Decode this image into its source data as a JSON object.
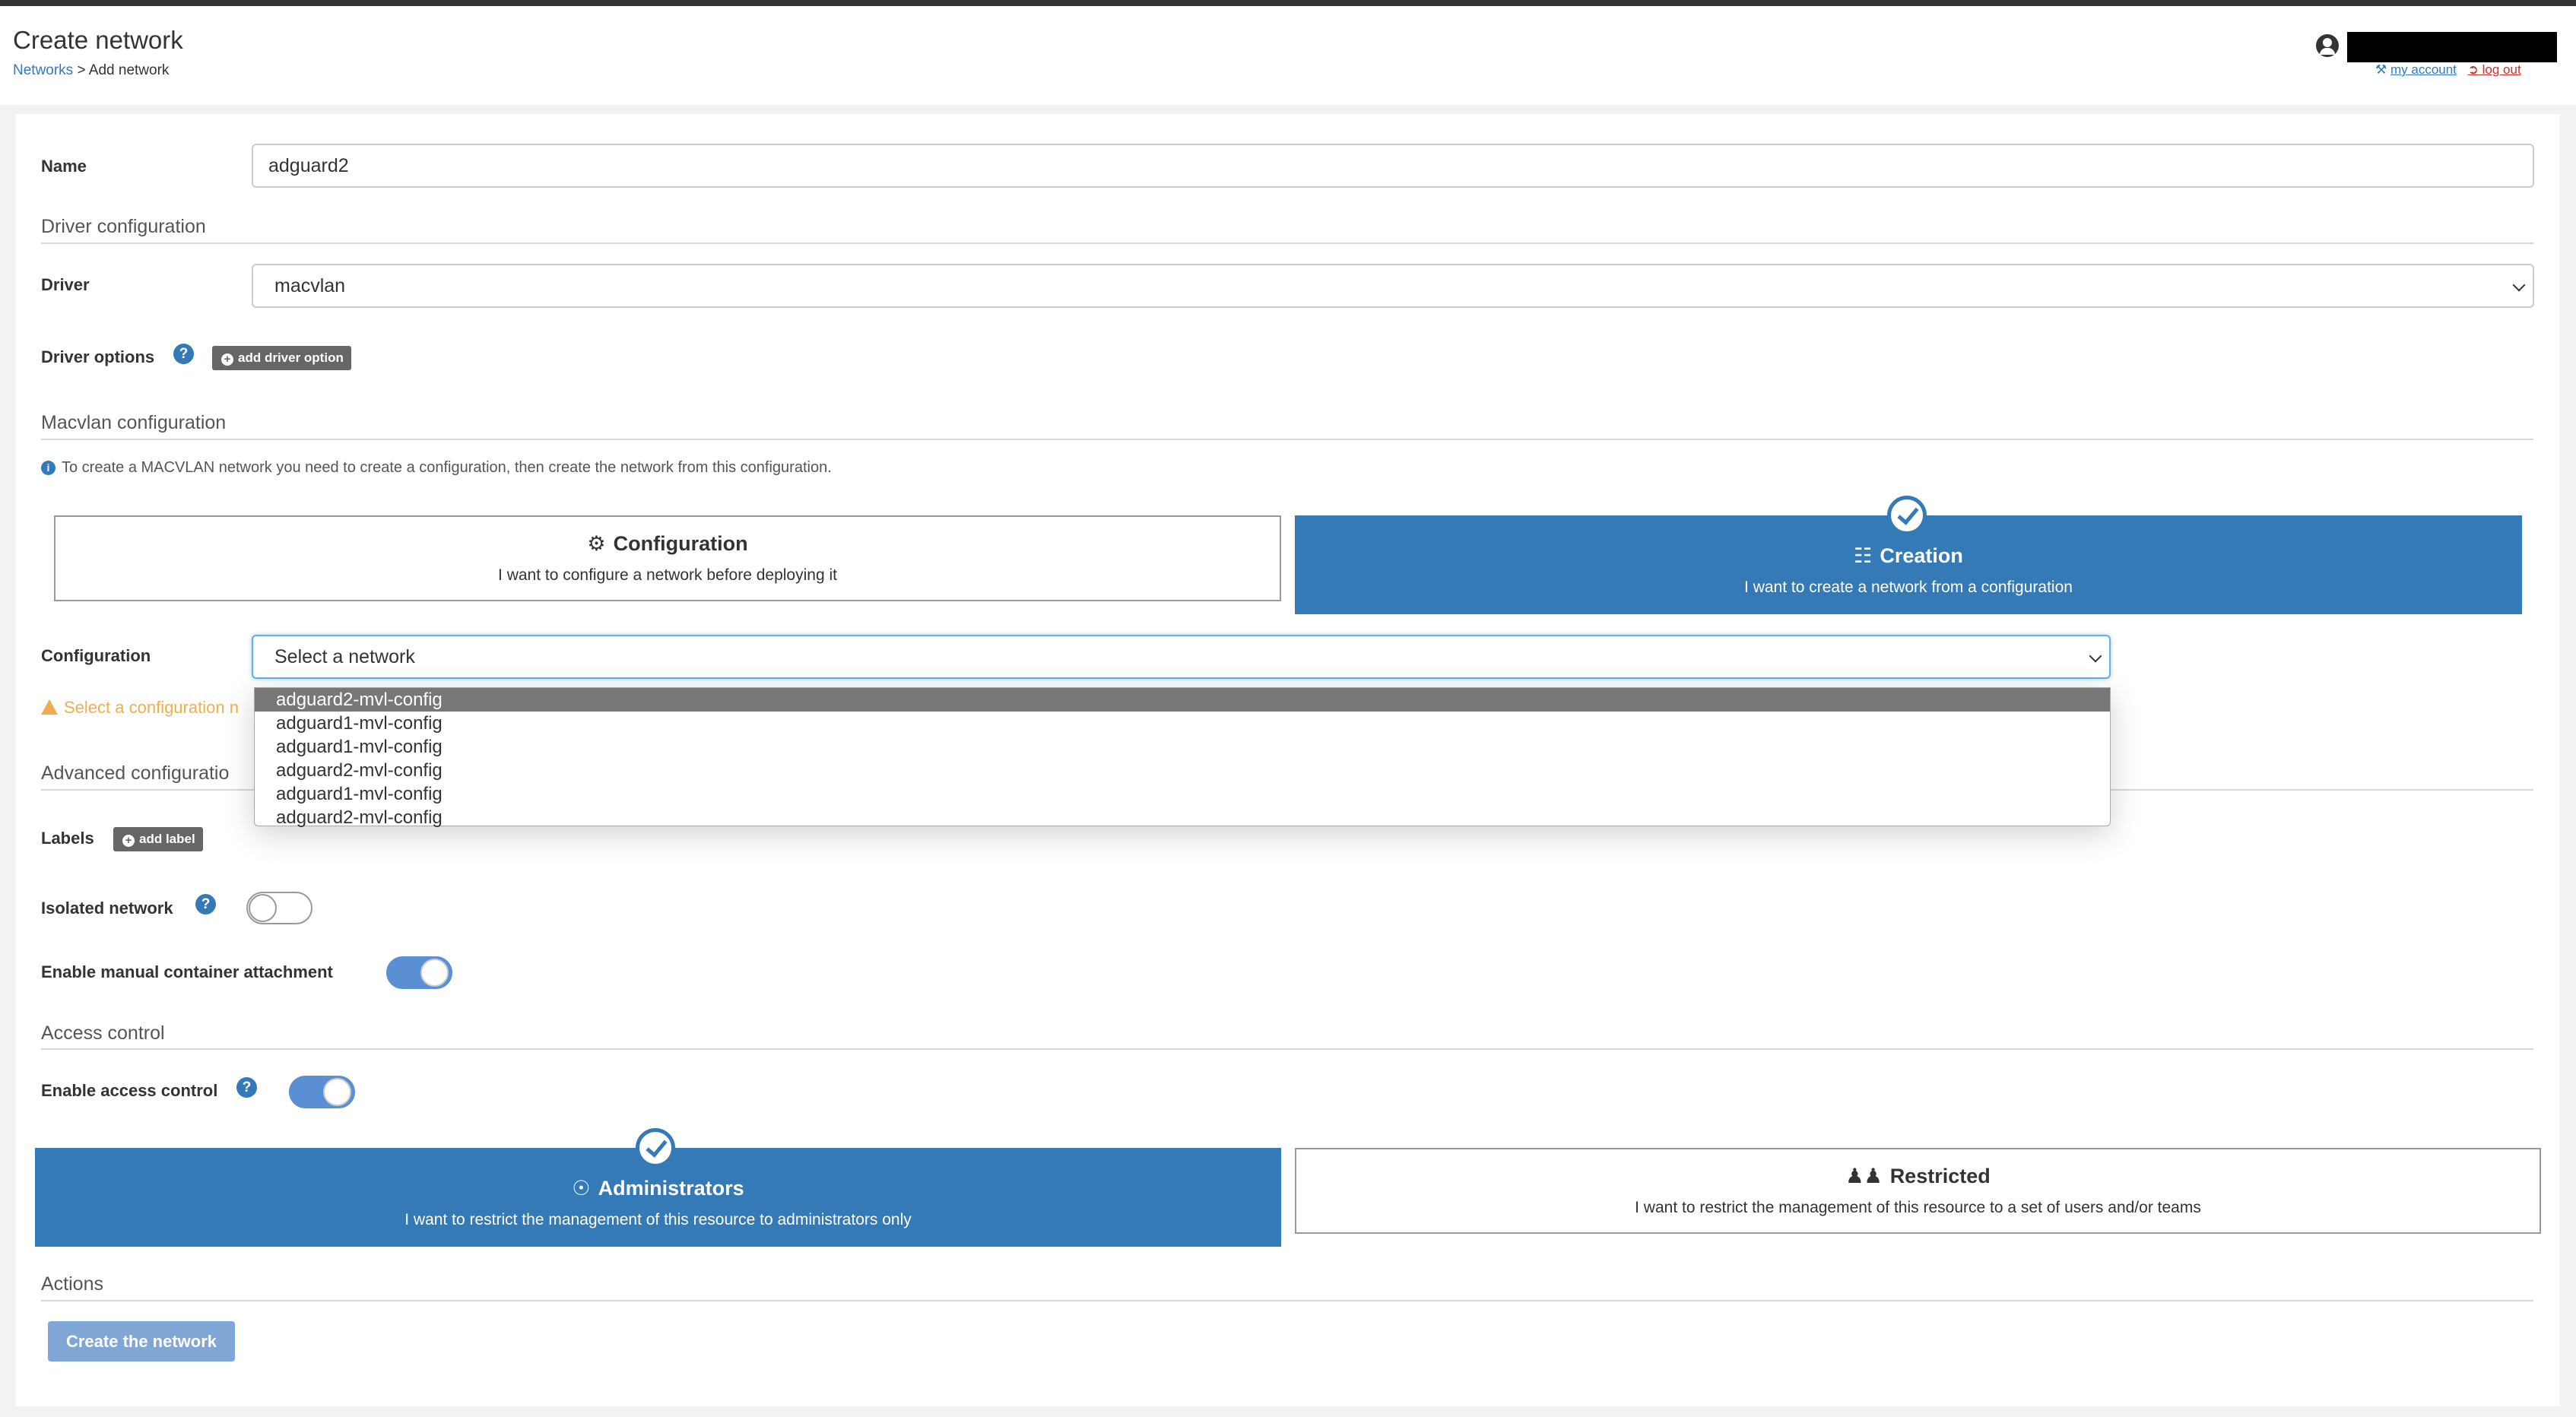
{
  "header": {
    "title": "Create network",
    "breadcrumb_link": "Networks",
    "breadcrumb_sep": " > ",
    "breadcrumb_current": "Add network",
    "user_name": "",
    "my_account": "my account",
    "log_out": "log out"
  },
  "form": {
    "name_label": "Name",
    "name_value": "adguard2",
    "driver_section": "Driver configuration",
    "driver_label": "Driver",
    "driver_value": "macvlan",
    "driver_options_label": "Driver options",
    "add_driver_option": "add driver option",
    "macvlan_section": "Macvlan configuration",
    "macvlan_info": "To create a MACVLAN network you need to create a configuration, then create the network from this configuration.",
    "mode_configuration": {
      "title": "Configuration",
      "desc": "I want to configure a network before deploying it",
      "icon": "gear-icon"
    },
    "mode_creation": {
      "title": "Creation",
      "desc": "I want to create a network from a configuration",
      "icon": "sitemap-icon",
      "selected": true
    },
    "configuration_label": "Configuration",
    "configuration_placeholder": "Select a network",
    "configuration_options": [
      "adguard2-mvl-config",
      "adguard1-mvl-config",
      "adguard1-mvl-config",
      "adguard2-mvl-config",
      "adguard1-mvl-config",
      "adguard2-mvl-config"
    ],
    "configuration_warning": "Select a configuration n",
    "advanced_section": "Advanced configuratio",
    "labels_label": "Labels",
    "add_label": "add label",
    "isolated_label": "Isolated network",
    "isolated_on": false,
    "manual_attach_label": "Enable manual container attachment",
    "manual_attach_on": true
  },
  "access": {
    "section": "Access control",
    "enable_label": "Enable access control",
    "enable_on": true,
    "admins": {
      "title": "Administrators",
      "desc": "I want to restrict the management of this resource to administrators only",
      "icon": "eye-slash-icon",
      "selected": true
    },
    "restricted": {
      "title": "Restricted",
      "desc": "I want to restrict the management of this resource to a set of users and/or teams",
      "icon": "users-icon"
    }
  },
  "actions": {
    "section": "Actions",
    "create_button": "Create the network"
  },
  "colors": {
    "primary": "#337ab7",
    "warning": "#f0ad4e",
    "logout": "#c9302c"
  }
}
